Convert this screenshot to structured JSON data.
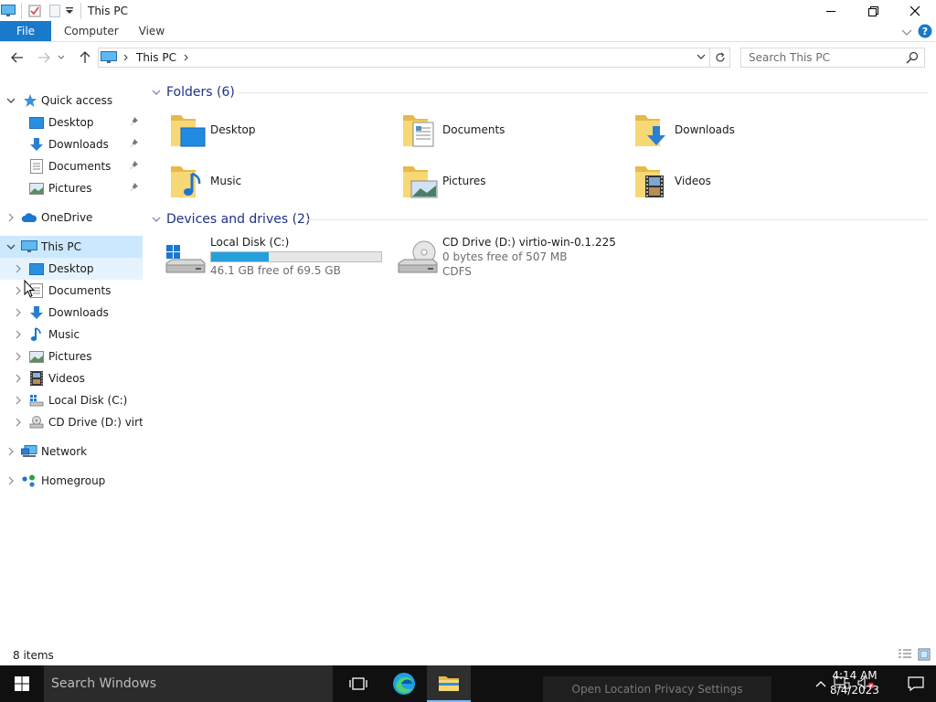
{
  "window": {
    "title": "This PC",
    "controls": [
      "minimize",
      "restore",
      "close"
    ]
  },
  "ribbon": {
    "tabs": [
      "File",
      "Computer",
      "View"
    ]
  },
  "address": {
    "crumb": "This PC",
    "search_placeholder": "Search This PC"
  },
  "nav": {
    "quick_access": "Quick access",
    "quick_items": [
      "Desktop",
      "Downloads",
      "Documents",
      "Pictures"
    ],
    "onedrive": "OneDrive",
    "this_pc": "This PC",
    "this_pc_items": [
      "Desktop",
      "Documents",
      "Downloads",
      "Music",
      "Pictures",
      "Videos",
      "Local Disk (C:)",
      "CD Drive (D:) virtio-"
    ],
    "network": "Network",
    "homegroup": "Homegroup"
  },
  "content": {
    "folders_header": "Folders (6)",
    "folders": [
      "Desktop",
      "Documents",
      "Downloads",
      "Music",
      "Pictures",
      "Videos"
    ],
    "devices_header": "Devices and drives (2)",
    "drives": [
      {
        "name": "Local Disk (C:)",
        "free": "46.1 GB free of 69.5 GB",
        "used_fraction": 0.337
      },
      {
        "name": "CD Drive (D:) virtio-win-0.1.225",
        "free": "0 bytes free of 507 MB",
        "fs": "CDFS"
      }
    ]
  },
  "status": {
    "items": "8 items"
  },
  "taskbar": {
    "search": "Search Windows",
    "toast": "Open Location Privacy Settings",
    "time": "4:14 AM",
    "date": "8/4/2023"
  },
  "colors": {
    "accent": "#1979ca",
    "selection": "#cce8ff",
    "group_header": "#1e3287",
    "drive_fill": "#26a0da"
  }
}
